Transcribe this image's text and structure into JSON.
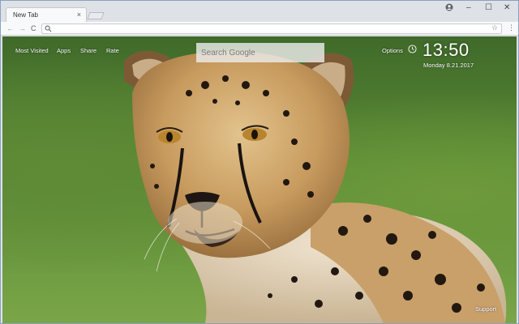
{
  "browser": {
    "tab_title": "New Tab",
    "tab_close": "×",
    "window_controls": {
      "minimize": "–",
      "maximize": "☐",
      "close": "✕"
    },
    "nav": {
      "back": "←",
      "forward": "→",
      "reload": "C"
    },
    "omnibox_value": "",
    "star": "☆",
    "menu": "⋮",
    "icons": [
      "profile-icon",
      "search-icon",
      "star-icon",
      "kebab-menu-icon"
    ]
  },
  "newtab": {
    "links": {
      "most_visited": "Most Visited",
      "apps": "Apps",
      "share": "Share",
      "rate": "Rate"
    },
    "search_placeholder": "Search Google",
    "options": "Options",
    "clock": {
      "time": "13:50",
      "date": "Monday  8.21.2017"
    },
    "support": "Support",
    "wallpaper_subject": "cheetah"
  },
  "colors": {
    "text_on_wallpaper": "#ffffff",
    "tabstrip": "#dee1e6",
    "toolbar": "#f8f9fa",
    "window_border": "#8aa1c1"
  }
}
